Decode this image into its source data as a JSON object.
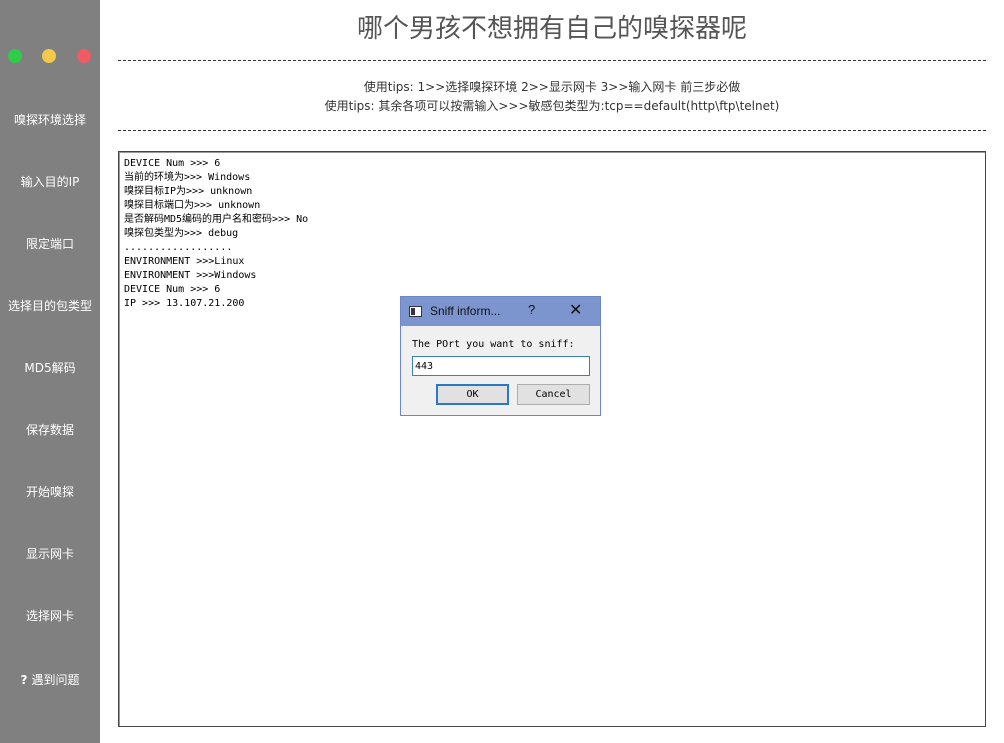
{
  "window_controls": {
    "green": "#2ecc47",
    "yellow": "#f2c94c",
    "red": "#f05a63"
  },
  "sidebar": {
    "items": [
      {
        "label": "嗅探环境选择"
      },
      {
        "label": "输入目的IP"
      },
      {
        "label": "限定端口"
      },
      {
        "label": "选择目的包类型"
      },
      {
        "label": "MD5解码"
      },
      {
        "label": "保存数据"
      },
      {
        "label": "开始嗅探"
      },
      {
        "label": "显示网卡"
      },
      {
        "label": "选择网卡"
      },
      {
        "label": "遇到问题",
        "icon": "question-icon",
        "icon_glyph": "?"
      }
    ]
  },
  "header": {
    "title": "哪个男孩不想拥有自己的嗅探器呢",
    "tip1": "使用tips: 1>>选择嗅探环境    2>>显示网卡    3>>输入网卡    前三步必做",
    "tip2": "使用tips: 其余各项可以按需输入>>>敏感包类型为:tcp==default(http\\ftp\\telnet)"
  },
  "log": {
    "lines": [
      "DEVICE Num >>> 6",
      "当前的环境为>>> Windows",
      "嗅探目标IP为>>> unknown",
      "嗅探目标端口为>>> unknown",
      "是否解码MD5编码的用户名和密码>>> No",
      "嗅探包类型为>>> debug",
      "..................",
      "ENVIRONMENT >>>Linux",
      "ENVIRONMENT >>>Windows",
      "DEVICE Num >>> 6",
      "IP >>> 13.107.21.200"
    ]
  },
  "dialog": {
    "title": "Sniff inform...",
    "help": "?",
    "close": "✕",
    "label": "The POrt you want to sniff:",
    "input_value": "443",
    "ok_label": "OK",
    "cancel_label": "Cancel"
  }
}
